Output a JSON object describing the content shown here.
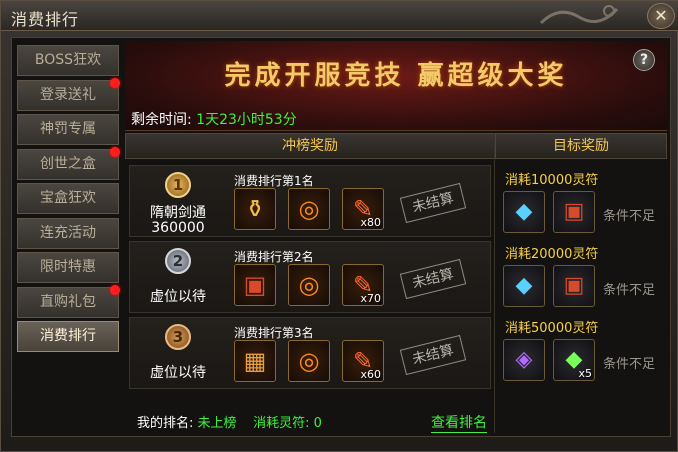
{
  "window": {
    "title": "消费排行"
  },
  "sidebar": {
    "items": [
      {
        "label": "BOSS狂欢",
        "badge": false,
        "active": false
      },
      {
        "label": "登录送礼",
        "badge": true,
        "active": false
      },
      {
        "label": "神罚专属",
        "badge": false,
        "active": false
      },
      {
        "label": "创世之盒",
        "badge": true,
        "active": false
      },
      {
        "label": "宝盒狂欢",
        "badge": false,
        "active": false
      },
      {
        "label": "连充活动",
        "badge": false,
        "active": false
      },
      {
        "label": "限时特惠",
        "badge": false,
        "active": false
      },
      {
        "label": "直购礼包",
        "badge": true,
        "active": false
      },
      {
        "label": "消费排行",
        "badge": false,
        "active": true
      }
    ]
  },
  "banner": {
    "title": "完成开服竞技  赢超级大奖",
    "help": "?"
  },
  "timer": {
    "label": "剩余时间:",
    "value": "1天23小时53分"
  },
  "columns": {
    "rank_rewards": "冲榜奖励",
    "target_rewards": "目标奖励"
  },
  "ranks": [
    {
      "medal": "1",
      "player": "隋朝剑通",
      "score": "360000",
      "label": "消费排行第1名",
      "items": [
        {
          "icon": "golden-chest-icon",
          "qty": ""
        },
        {
          "icon": "fire-ring-icon",
          "qty": ""
        },
        {
          "icon": "feather-icon",
          "qty": "x80"
        }
      ],
      "status": "未结算"
    },
    {
      "medal": "2",
      "player": "虚位以待",
      "score": "",
      "label": "消费排行第2名",
      "items": [
        {
          "icon": "red-chest-icon",
          "qty": ""
        },
        {
          "icon": "fire-ring-icon",
          "qty": ""
        },
        {
          "icon": "feather-icon",
          "qty": "x70"
        }
      ],
      "status": "未结算"
    },
    {
      "medal": "3",
      "player": "虚位以待",
      "score": "",
      "label": "消费排行第3名",
      "items": [
        {
          "icon": "treasure-chest-icon",
          "qty": ""
        },
        {
          "icon": "fire-ring-icon",
          "qty": ""
        },
        {
          "icon": "feather-icon",
          "qty": "x60"
        }
      ],
      "status": "未结算"
    }
  ],
  "targets": [
    {
      "title": "消耗10000灵符",
      "items": [
        {
          "icon": "crystal-icon",
          "qty": ""
        },
        {
          "icon": "red-chest-icon",
          "qty": ""
        }
      ],
      "condition": "条件不足"
    },
    {
      "title": "消耗20000灵符",
      "items": [
        {
          "icon": "crystal-icon",
          "qty": ""
        },
        {
          "icon": "red-chest-icon",
          "qty": ""
        }
      ],
      "condition": "条件不足"
    },
    {
      "title": "消耗50000灵符",
      "items": [
        {
          "icon": "purple-gem-icon",
          "qty": ""
        },
        {
          "icon": "green-gem-icon",
          "qty": "x5"
        }
      ],
      "condition": "条件不足"
    }
  ],
  "footer": {
    "my_rank_label": "我的排名:",
    "my_rank_value": "未上榜",
    "consume_label": "消耗灵符:",
    "consume_value": "0",
    "view_rank": "查看排名"
  }
}
